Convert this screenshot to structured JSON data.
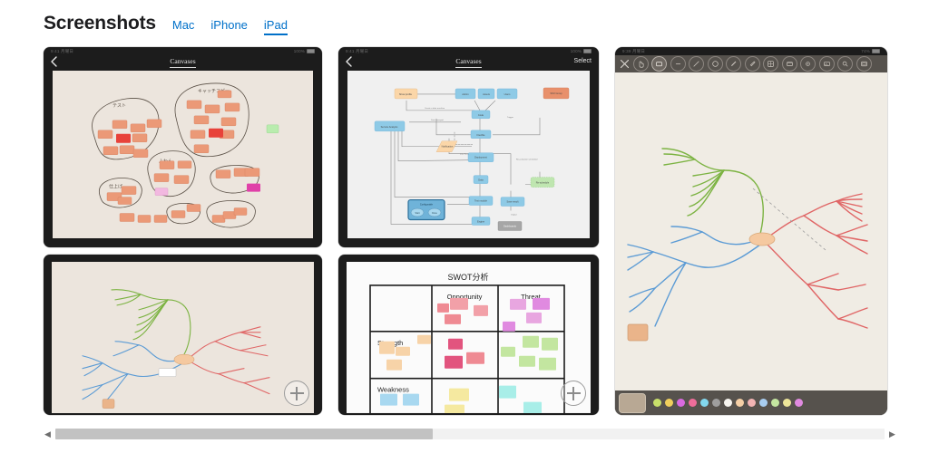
{
  "header": {
    "title": "Screenshots",
    "platforms": [
      {
        "label": "Mac",
        "active": false
      },
      {
        "label": "iPhone",
        "active": false
      },
      {
        "label": "iPad",
        "active": true
      }
    ]
  },
  "screenshots": {
    "canvases_sticky": {
      "status_left": "9:41  月曜日",
      "status_right": "100%",
      "nav_title": "Canvases",
      "back_icon": "chevron-left-icon",
      "canvas_kind": "sticky-note-clusters",
      "cluster_labels": [
        "テスト",
        "キャッチコピー",
        "ふわん",
        "仕上げ"
      ],
      "note_color": "#eb9977",
      "note_highlight_color": "#e8423a",
      "note_accent_pink": "#e040a8",
      "note_accent_green": "#a8e6a0",
      "canvas_bg": "#ece5dd"
    },
    "mindmap_bottom_left": {
      "canvas_kind": "mind-map",
      "branch_colors": {
        "green": "#7cb342",
        "blue": "#5b9bd5",
        "red": "#e06666"
      },
      "center_node_color": "#f5c9a0",
      "fab_label": "+"
    },
    "canvases_flowchart": {
      "status_left": "9:41  月曜日",
      "status_right": "100%",
      "nav_title": "Canvases",
      "nav_action": "Select",
      "back_icon": "chevron-left-icon",
      "canvas_kind": "flowchart",
      "node_colors": {
        "blue": "#8ecae6",
        "orange": "#fbd6a8",
        "salmon": "#e8906b",
        "green": "#bfe6b0",
        "grey": "#a6a6a6",
        "group": "#6fb3d9"
      },
      "canvas_bg": "#f0f0f0"
    },
    "swot_bottom_middle": {
      "board_title": "SWOT分析",
      "columns": [
        "",
        "Opportunity",
        "Threat"
      ],
      "rows": [
        "Strength",
        "Weakness"
      ],
      "note_colors": {
        "opportunity": "#ef8a93",
        "threat": "#e8a6e0",
        "strength": "#f7d3a8",
        "strength_green": "#c3e6a0",
        "weakness_blue": "#a8d8f0",
        "weakness_yellow": "#f5e9a0",
        "weakness_cyan": "#a8eee8",
        "magenta": "#e2547e"
      },
      "fab_label": "+",
      "canvas_bg": "#e9e9e9"
    },
    "mindmap_editor": {
      "status_left": "9:39  月曜日",
      "status_right": "74%",
      "canvas_kind": "mind-map",
      "toolbar_icons": [
        "close-icon",
        "hand-select-icon",
        "rectangle-shape-icon",
        "minus-circle-icon",
        "line-icon",
        "circle-shape-icon",
        "pen-icon",
        "eraser-icon",
        "grid-table-icon",
        "sticky-note-icon",
        "dot-circle-icon",
        "image-icon",
        "search-icon",
        "note-card-icon"
      ],
      "selected_tool": "rectangle-shape-icon",
      "branch_colors": {
        "green": "#7cb342",
        "blue": "#5b9bd5",
        "red": "#e06666"
      },
      "center_node_color": "#f5c9a0",
      "palette_current_color": "#b8a894",
      "palette_colors": [
        "#c8e06a",
        "#f0cf5c",
        "#d96ae0",
        "#ef6d9a",
        "#82d8ee",
        "#9e9e9e",
        "#f7f5f0",
        "#f5cfa6",
        "#f2b4b4",
        "#a8cdf0",
        "#c4e6a0",
        "#eee69a",
        "#e08ae0"
      ],
      "canvas_bg": "#f0ece4"
    }
  },
  "scrollbar": {
    "left_arrow_icon": "triangle-left-icon",
    "right_arrow_icon": "triangle-right-icon",
    "thumb_percent": "45.5"
  }
}
